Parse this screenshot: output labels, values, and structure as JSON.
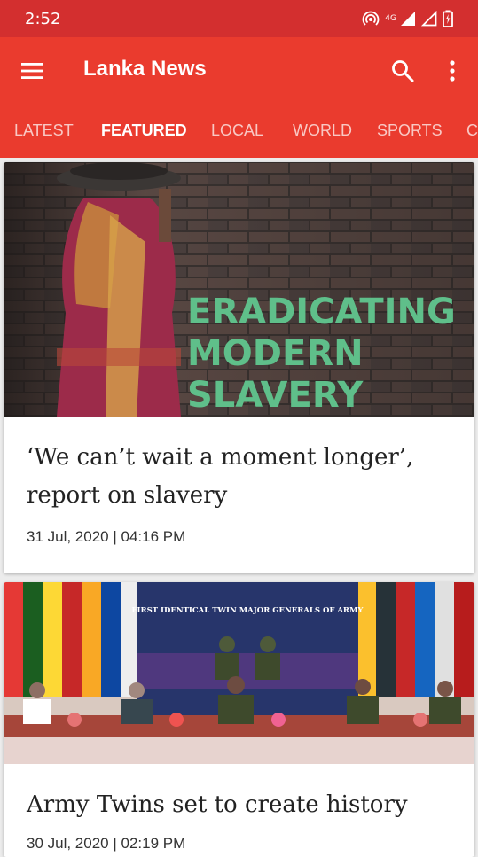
{
  "status_bar": {
    "time": "2:52",
    "network_label": "4G",
    "icons": [
      "hotspot-icon",
      "signal-icon",
      "signal-outline-icon",
      "battery-icon"
    ]
  },
  "app_bar": {
    "title": "Lanka News",
    "menu_icon": "menu-icon",
    "search_icon": "search-icon",
    "more_icon": "more-vert-icon"
  },
  "colors": {
    "status_bar": "#d32f2f",
    "app_bar": "#ea3b2e",
    "text_dark": "#222222",
    "background": "#ececec"
  },
  "tabs": [
    {
      "label": "LATEST",
      "active": false
    },
    {
      "label": "FEATURED",
      "active": true
    },
    {
      "label": "LOCAL",
      "active": false
    },
    {
      "label": "WORLD",
      "active": false
    },
    {
      "label": "SPORTS",
      "active": false
    },
    {
      "label": "C",
      "active": false
    }
  ],
  "articles": [
    {
      "image_text": [
        "ERADICATING",
        "MODERN",
        "SLAVERY"
      ],
      "headline": "‘We can’t wait a moment longer’, report on slavery",
      "date": "31 Jul, 2020 | 04:16 PM"
    },
    {
      "image_text": [
        "FIRST IDENTICAL TWIN MAJOR GENERALS OF ARMY"
      ],
      "headline": "Army Twins set to create history",
      "date": "30 Jul, 2020 | 02:19 PM"
    }
  ]
}
